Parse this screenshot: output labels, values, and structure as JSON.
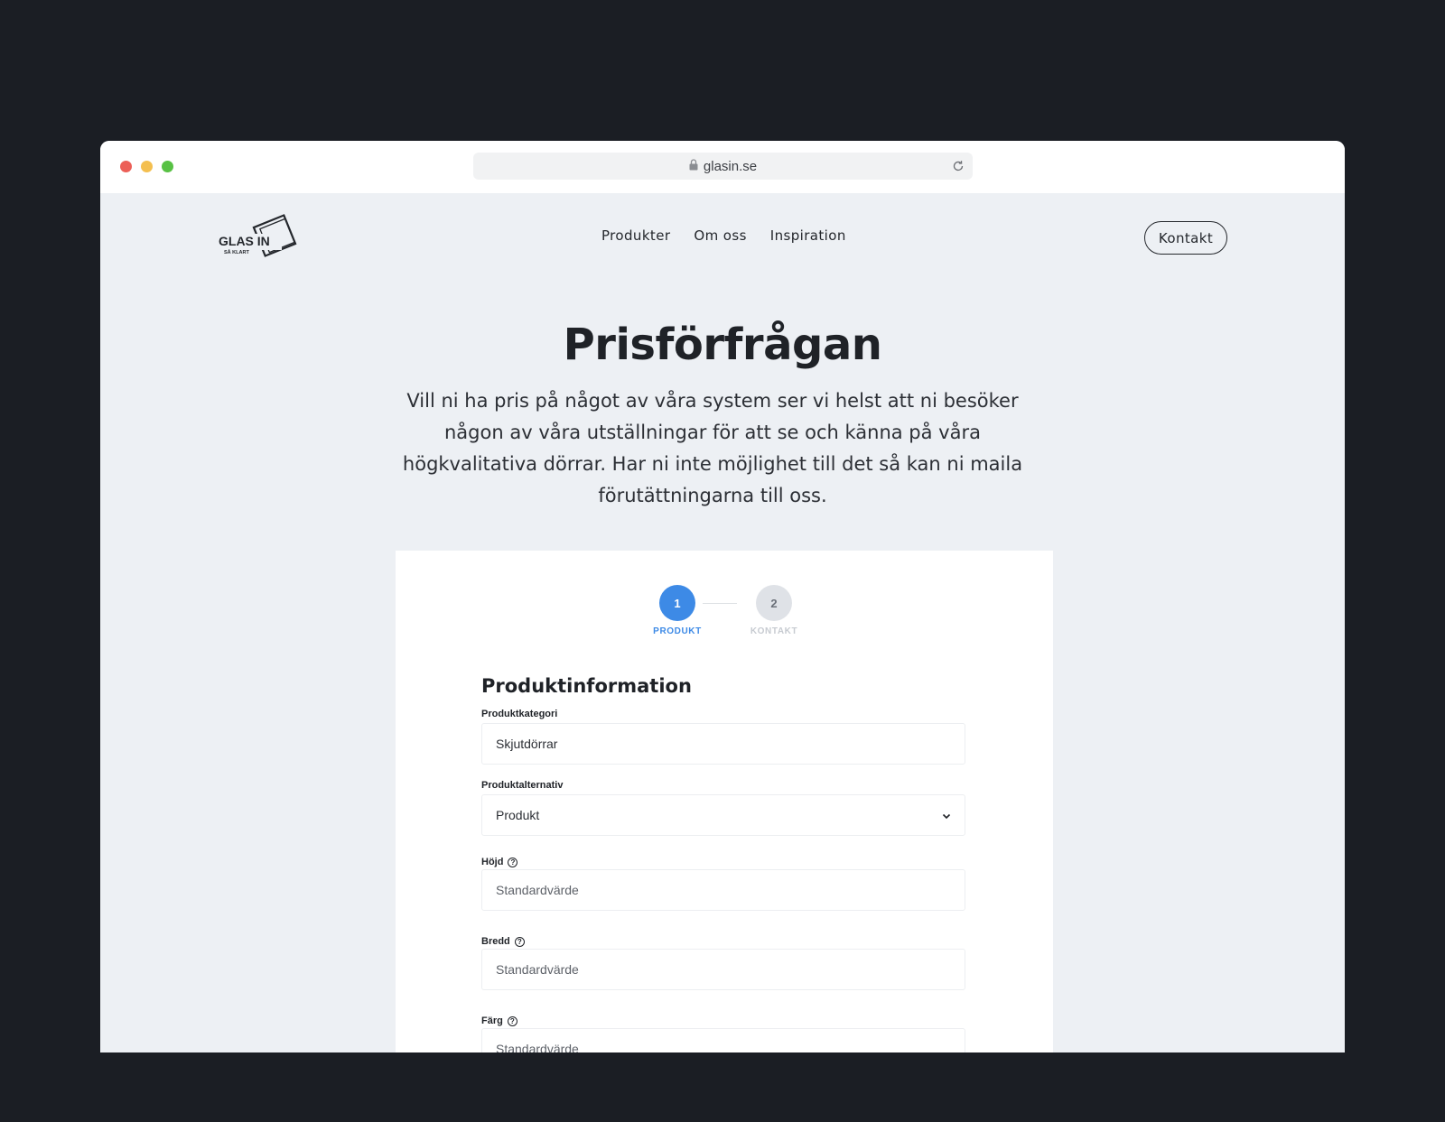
{
  "browser": {
    "url": "glasin.se",
    "lock_icon": "lock-icon",
    "reload_icon": "reload-icon"
  },
  "header": {
    "logo_text": "GLAS IN",
    "logo_subtext": "SÅ KLART",
    "nav": [
      {
        "label": "Produkter"
      },
      {
        "label": "Om oss"
      },
      {
        "label": "Inspiration"
      }
    ],
    "contact_label": "Kontakt"
  },
  "hero": {
    "title": "Prisförfrågan",
    "intro": "Vill ni ha pris på något av våra system ser vi helst att ni besöker någon av våra utställningar för att se och känna på våra högkvalitativa dörrar. Har ni inte möjlighet till det så kan ni maila förutättningarna till oss."
  },
  "form": {
    "steps": [
      {
        "number": "1",
        "label": "PRODUKT",
        "active": true
      },
      {
        "number": "2",
        "label": "KONTAKT",
        "active": false
      }
    ],
    "section_title": "Produktinformation",
    "fields": {
      "category": {
        "label": "Produktkategori",
        "value": "Skjutdörrar"
      },
      "alternative": {
        "label": "Produktalternativ",
        "value": "Produkt"
      },
      "height": {
        "label": "Höjd",
        "placeholder": "Standardvärde"
      },
      "width": {
        "label": "Bredd",
        "placeholder": "Standardvärde"
      },
      "color": {
        "label": "Färg",
        "placeholder": "Standardvärde"
      }
    },
    "help_glyph": "?"
  },
  "colors": {
    "accent": "#3d8ae6",
    "page_bg": "#edf0f4",
    "outer_bg": "#1b1e24"
  }
}
